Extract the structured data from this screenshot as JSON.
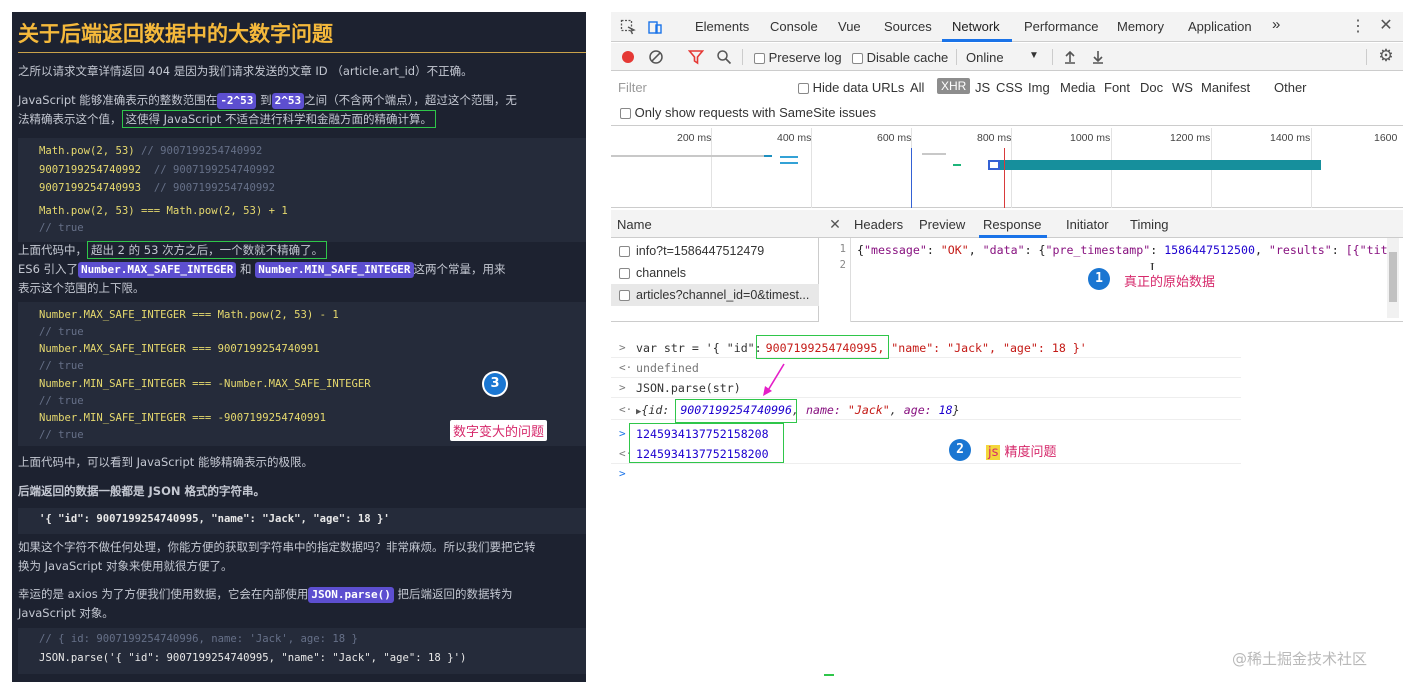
{
  "article": {
    "title": "关于后端返回数据中的大数字问题",
    "p1": "之所以请求文章详情返回 404 是因为我们请求发送的文章 ID （article.art_id）不正确。",
    "p2_a": "JavaScript 能够准确表示的整数范围在",
    "p2_hl1": "-2^53",
    "p2_mid": "到",
    "p2_hl2": "2^53",
    "p2_b": "之间（不含两个端点），超过这个范围，无",
    "p2_c": "法精确表示这个值，",
    "p2_box": "这使得 JavaScript 不适合进行科学和金融方面的精确计算。",
    "code1": [
      {
        "code": "Math.pow(2, 53)",
        "comment": " // 9007199254740992"
      },
      {
        "code": "9007199254740992",
        "comment": "  // 9007199254740992"
      },
      {
        "code": "9007199254740993",
        "comment": "  // 9007199254740992"
      },
      {
        "code": "",
        "comment": ""
      },
      {
        "code": "Math.pow(2, 53) === Math.pow(2, 53) + 1",
        "comment": ""
      },
      {
        "code": "",
        "comment": "// true"
      }
    ],
    "p3_a": "上面代码中，",
    "p3_box": "超出 2 的 53 次方之后，一个数就不精确了。",
    "p4_a": "ES6 引入了",
    "p4_hl1": "Number.MAX_SAFE_INTEGER",
    "p4_mid": "和",
    "p4_hl2": "Number.MIN_SAFE_INTEGER",
    "p4_b": "这两个常量，用来",
    "p4_c": "表示这个范围的上下限。",
    "code2": [
      {
        "code": "Number.MAX_SAFE_INTEGER === Math.pow(2, 53) - 1",
        "comment": ""
      },
      {
        "code": "",
        "comment": "// true"
      },
      {
        "code": "Number.MAX_SAFE_INTEGER === 9007199254740991",
        "comment": ""
      },
      {
        "code": "",
        "comment": "// true"
      },
      {
        "code": "Number.MIN_SAFE_INTEGER === -Number.MAX_SAFE_INTEGER",
        "comment": ""
      },
      {
        "code": "",
        "comment": "// true"
      },
      {
        "code": "Number.MIN_SAFE_INTEGER === -9007199254740991",
        "comment": ""
      },
      {
        "code": "",
        "comment": "// true"
      }
    ],
    "badge3": "3",
    "label3": "数字变大的问题",
    "p5": "上面代码中，可以看到 JavaScript 能够精确表示的极限。",
    "p6": "后端返回的数据一般都是 JSON 格式的字符串。",
    "code3": "'{ \"id\": 9007199254740995, \"name\": \"Jack\", \"age\": 18 }'",
    "p7": "如果这个字符不做任何处理，你能方便的获取到字符串中的指定数据吗？非常麻烦。所以我们要把它转",
    "p7b": "换为 JavaScript 对象来使用就很方便了。",
    "p8_a": "幸运的是 axios 为了方便我们使用数据，它会在内部使用",
    "p8_hl": "JSON.parse()",
    "p8_b": "把后端返回的数据转为",
    "p8_c": "JavaScript 对象。",
    "code4_comment": "// { id: 9007199254740996, name: 'Jack', age: 18 }",
    "code4_code": "JSON.parse('{ \"id\": 9007199254740995, \"name\": \"Jack\", \"age\": 18 }')"
  },
  "devtools": {
    "tabs": [
      "Elements",
      "Console",
      "Vue",
      "Sources",
      "Network",
      "Performance",
      "Memory",
      "Application"
    ],
    "more_tabs": "»",
    "preserve_log": "Preserve log",
    "disable_cache": "Disable cache",
    "throttle": "Online",
    "filter_placeholder": "Filter",
    "hide_data_urls": "Hide data URLs",
    "type_filters": [
      "All",
      "XHR",
      "JS",
      "CSS",
      "Img",
      "Media",
      "Font",
      "Doc",
      "WS",
      "Manifest",
      "Other"
    ],
    "samesite": "Only show requests with SameSite issues",
    "ticks": [
      "200 ms",
      "400 ms",
      "600 ms",
      "800 ms",
      "1000 ms",
      "1200 ms",
      "1400 ms",
      "1600"
    ],
    "name_header": "Name",
    "requests": [
      "info?t=1586447512479",
      "channels",
      "articles?channel_id=0&timest..."
    ],
    "resp_tabs": [
      "Headers",
      "Preview",
      "Response",
      "Initiator",
      "Timing"
    ],
    "resp_line1_parts": {
      "k1": "\"message\"",
      "v1": "\"OK\"",
      "k2": "\"data\"",
      "k3": "\"pre_timestamp\"",
      "v3": "1586447512500",
      "k4": "\"results\"",
      "tail": "[{\"titl"
    },
    "badge1": "1",
    "label1": "真正的原始数据",
    "console": {
      "l1_prefix": "var str = '{ \"id\":",
      "l1_boxed": "9007199254740995,",
      "l1_suffix": " \"name\": \"Jack\", \"age\": 18 }'",
      "l2": "undefined",
      "l3": "JSON.parse(str)",
      "l4_prefix": "{id:",
      "l4_boxed": "9007199254740996",
      "l4_suffix1": "name:",
      "l4_name": "\"Jack\"",
      "l4_suffix2": "age:",
      "l4_age": "18",
      "l5": "1245934137752158208",
      "l6": "1245934137752158200"
    },
    "badge2": "2",
    "label2_a": "js",
    "label2_b": "精度问题"
  },
  "watermark": "@稀土掘金技术社区",
  "colors": {
    "article_bg": "#1d2230",
    "title": "#f5b93b",
    "highlight": "#5d4fd0",
    "green_box": "#2fc64a",
    "badge_blue": "#1a76d2",
    "label_pink": "#d6296b",
    "devtools_active": "#1a73e8"
  }
}
